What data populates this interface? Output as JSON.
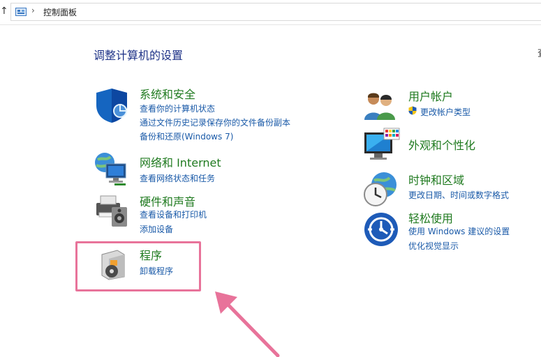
{
  "address": {
    "up_glyph": "↑",
    "separator": "›",
    "path": "控制面板"
  },
  "page": {
    "title": "调整计算机的设置",
    "view_by_partial": "查"
  },
  "left_column": [
    {
      "title": "系统和安全",
      "icon": "shield-icon",
      "links": [
        "查看你的计算机状态",
        "通过文件历史记录保存你的文件备份副本",
        "备份和还原(Windows 7)"
      ]
    },
    {
      "title": "网络和 Internet",
      "icon": "network-globe-icon",
      "links": [
        "查看网络状态和任务"
      ]
    },
    {
      "title": "硬件和声音",
      "icon": "printer-speaker-icon",
      "links": [
        "查看设备和打印机",
        "添加设备"
      ]
    },
    {
      "title": "程序",
      "icon": "programs-disc-icon",
      "links": [
        "卸载程序"
      ]
    }
  ],
  "right_column": [
    {
      "title": "用户帐户",
      "icon": "users-icon",
      "links": [
        "更改帐户类型"
      ],
      "link_icon": "uac-shield-icon"
    },
    {
      "title": "外观和个性化",
      "icon": "monitor-palette-icon",
      "links": []
    },
    {
      "title": "时钟和区域",
      "icon": "clock-globe-icon",
      "links": [
        "更改日期、时间或数字格式"
      ]
    },
    {
      "title": "轻松使用",
      "icon": "ease-of-access-icon",
      "links": [
        "使用 Windows 建议的设置",
        "优化视觉显示"
      ]
    }
  ],
  "colors": {
    "category_title": "#1f7a1f",
    "link": "#1a5aa8",
    "page_title": "#1e3287",
    "highlight": "#e8739a"
  }
}
